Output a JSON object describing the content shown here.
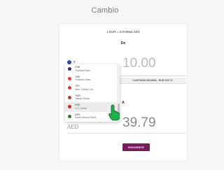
{
  "page": {
    "title": "Cambio"
  },
  "converter": {
    "rate": "1 EUR = 3.978564 AED",
    "from_label": "De",
    "from_amount": "10.00",
    "max_label": "CANTIDAD MÁXIMA : EUR 219.72",
    "to_label": "A",
    "to_currency": "AED",
    "to_amount": "39.79",
    "next_button": "SIGUIENTE"
  },
  "dropdown": {
    "items": [
      {
        "code": "THB",
        "name": "Thailand Bath",
        "flag_color": "#2d2a8a",
        "flag_icon": "thailand-flag-icon"
      },
      {
        "code": "TND",
        "name": "Tunisian Dinar",
        "flag_color": "#e53935",
        "flag_icon": "tunisia-flag-icon"
      },
      {
        "code": "TRY",
        "name": "New Turkish Lira",
        "flag_color": "#e53935",
        "flag_icon": "turkey-flag-icon"
      },
      {
        "code": "TWD",
        "name": "Taiwan Dollar",
        "flag_color": "#d32f2f",
        "flag_icon": "taiwan-flag-icon"
      },
      {
        "code": "USD",
        "name": "U.S. Dollar",
        "flag_color": "#c62828",
        "flag_icon": "usa-flag-icon",
        "selected": true
      },
      {
        "code": "ZAR",
        "name": "South African Rand",
        "flag_color": "#2e7d32",
        "flag_icon": "south-africa-flag-icon"
      }
    ]
  },
  "colors": {
    "accent": "#7a1a5f",
    "cursor": "#22b14c"
  }
}
